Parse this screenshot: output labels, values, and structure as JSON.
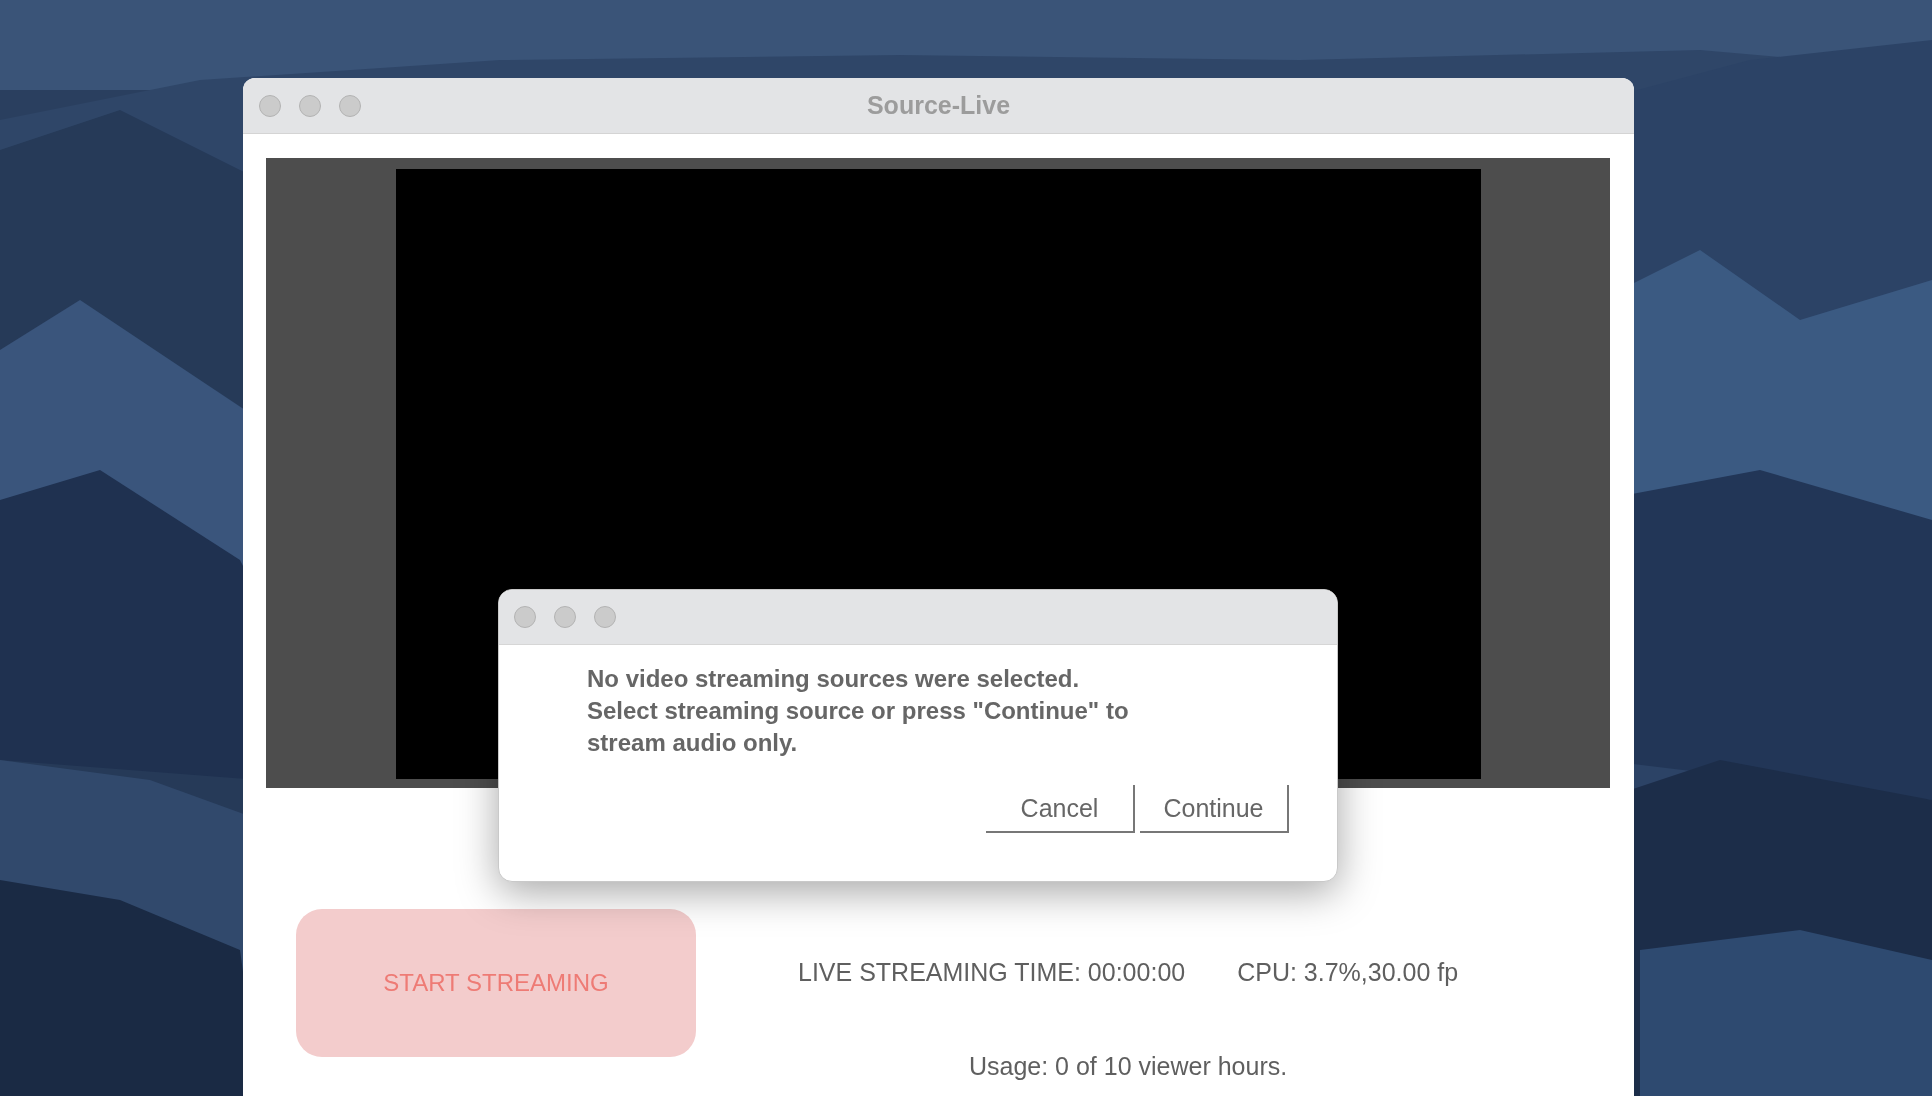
{
  "window": {
    "title": "Source-Live"
  },
  "controls": {
    "start_button": "START STREAMING",
    "live_time": "LIVE STREAMING TIME: 00:00:00",
    "cpu": "CPU: 3.7%,30.00 fp",
    "usage": "Usage: 0 of 10 viewer hours."
  },
  "dialog": {
    "message_lines": [
      "No video streaming sources were selected.",
      "Select streaming source or press \"Continue\" to",
      "stream audio only."
    ],
    "buttons": [
      "Cancel",
      "Continue"
    ]
  }
}
